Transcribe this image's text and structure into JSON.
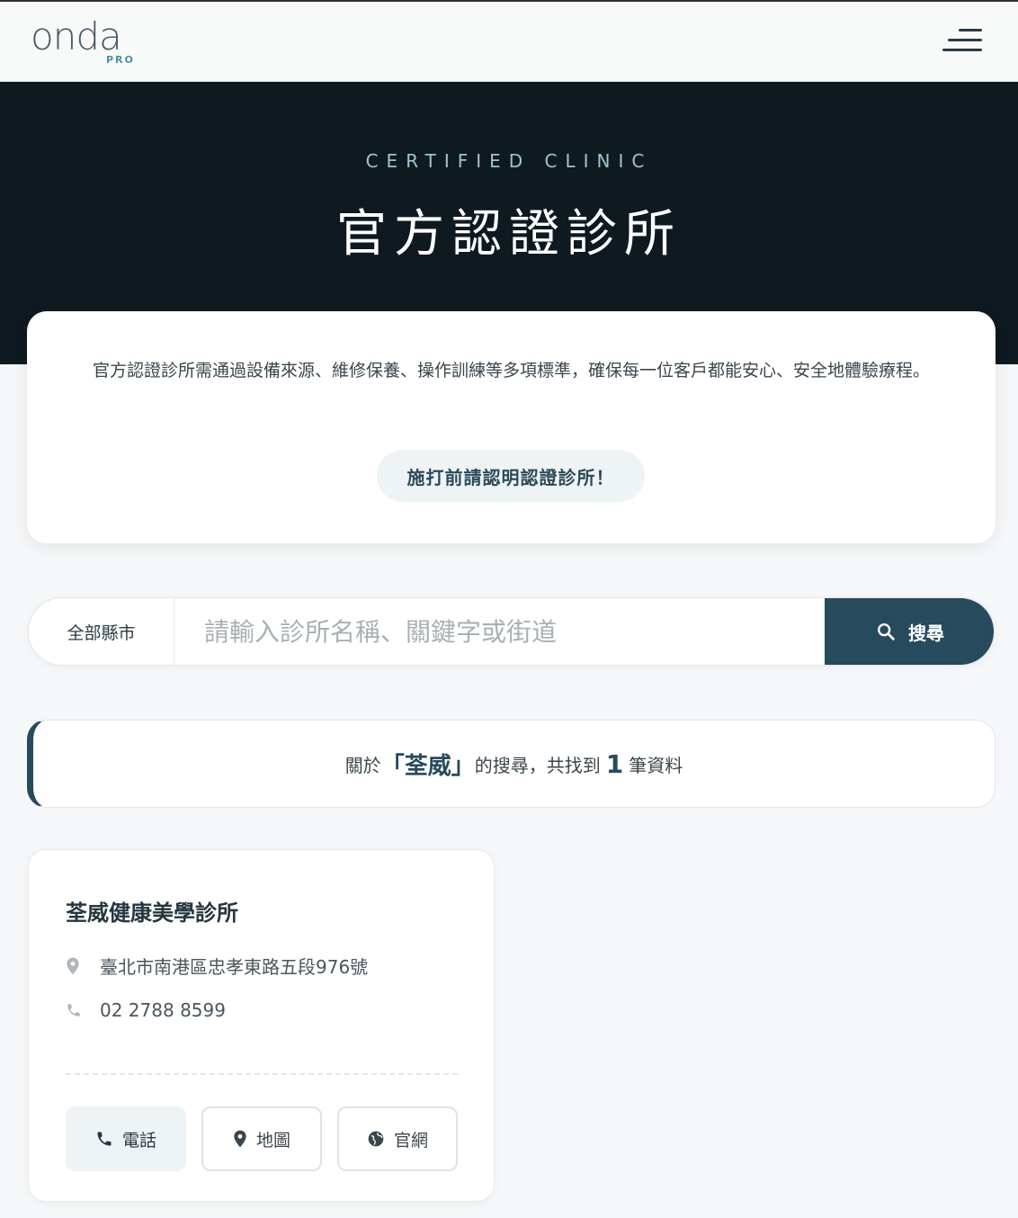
{
  "header": {
    "logo_text": "onda",
    "logo_sub": "PRO",
    "menu_icon": "hamburger-menu-icon"
  },
  "hero": {
    "subtitle": "CERTIFIED CLINIC",
    "title": "官方認證診所"
  },
  "intro": {
    "description": "官方認證診所需通過設備來源、維修保養、操作訓練等多項標準，確保每一位客戶都能安心、安全地體驗療程。",
    "notice": "施打前請認明認證診所！"
  },
  "search": {
    "region_label": "全部縣市",
    "placeholder": "請輸入診所名稱、關鍵字或街道",
    "value": "",
    "button_label": "搜尋",
    "button_icon": "search-icon"
  },
  "result": {
    "prefix": "關於",
    "keyword": "「荃威」",
    "middle": "的搜尋，共找到",
    "count": "1",
    "suffix": "筆資料"
  },
  "clinics": [
    {
      "name": "荃威健康美學診所",
      "address": "臺北市南港區忠孝東路五段976號",
      "phone": "02 2788 8599",
      "actions": {
        "phone_label": "電話",
        "map_label": "地圖",
        "web_label": "官網"
      }
    }
  ],
  "colors": {
    "brand_dark": "#274a5c",
    "hero_bg": "#0f1a20",
    "accent_light": "#9fc3d2"
  }
}
